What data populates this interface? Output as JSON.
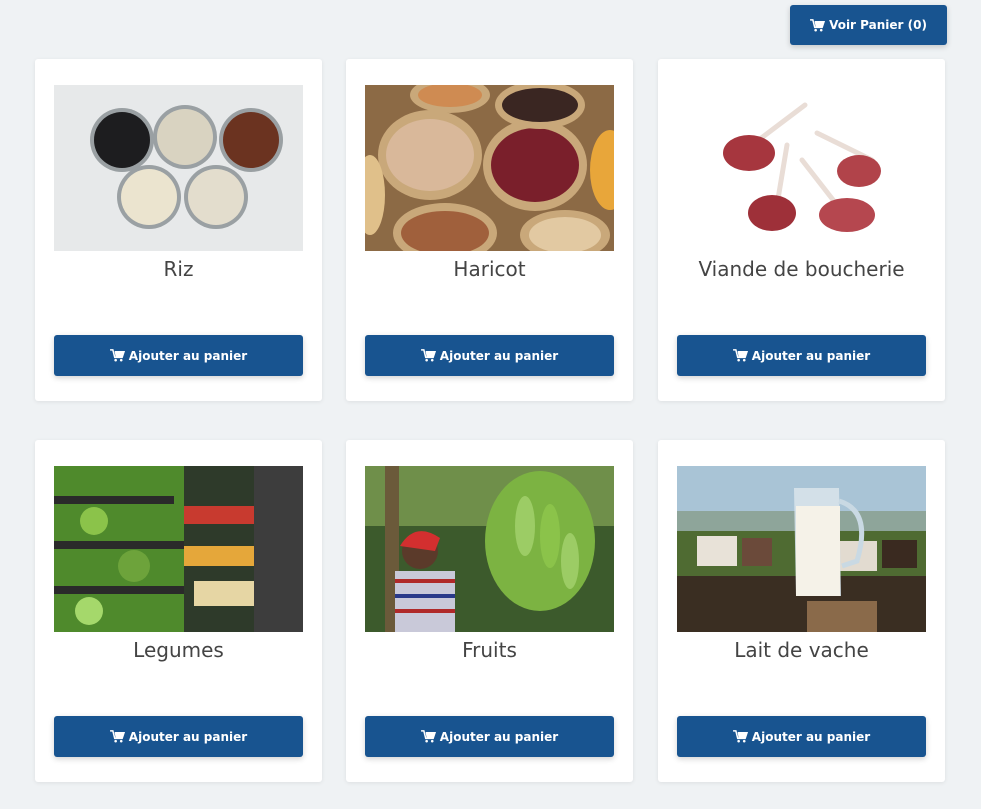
{
  "header": {
    "cart_label": "Voir Panier (0)"
  },
  "products": [
    {
      "name": "Riz",
      "button_label": "Ajouter au panier"
    },
    {
      "name": "Haricot",
      "button_label": "Ajouter au panier"
    },
    {
      "name": "Viande de boucherie",
      "button_label": "Ajouter au panier"
    },
    {
      "name": "Legumes",
      "button_label": "Ajouter au panier"
    },
    {
      "name": "Fruits",
      "button_label": "Ajouter au panier"
    },
    {
      "name": "Lait de vache",
      "button_label": "Ajouter au panier"
    }
  ],
  "icons": {
    "cart": "shopping-cart-icon"
  },
  "colors": {
    "primary": "#185490",
    "background": "#eff2f4",
    "card": "#ffffff",
    "title_text": "#444444"
  }
}
